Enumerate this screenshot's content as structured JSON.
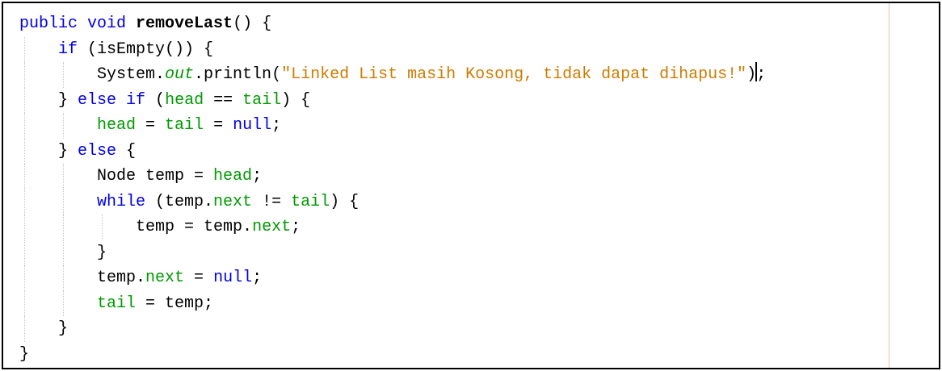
{
  "editor": {
    "lines": [
      {
        "indent": 0,
        "tokens": [
          {
            "t": "public void ",
            "c": "kw"
          },
          {
            "t": "removeLast",
            "c": "fn"
          },
          {
            "t": "() {",
            "c": ""
          }
        ]
      },
      {
        "indent": 1,
        "tokens": [
          {
            "t": "if",
            "c": "kw"
          },
          {
            "t": " (isEmpty()) {",
            "c": ""
          }
        ]
      },
      {
        "indent": 2,
        "tokens": [
          {
            "t": "System.",
            "c": ""
          },
          {
            "t": "out",
            "c": "stat"
          },
          {
            "t": ".println(",
            "c": ""
          },
          {
            "t": "\"Linked List masih Kosong, tidak dapat dihapus!\"",
            "c": "str"
          },
          {
            "t": ")",
            "c": ""
          },
          {
            "t": "|",
            "c": "caret"
          },
          {
            "t": ";",
            "c": ""
          }
        ]
      },
      {
        "indent": 1,
        "tokens": [
          {
            "t": "} ",
            "c": ""
          },
          {
            "t": "else if",
            "c": "kw"
          },
          {
            "t": " (",
            "c": ""
          },
          {
            "t": "head",
            "c": "field"
          },
          {
            "t": " == ",
            "c": ""
          },
          {
            "t": "tail",
            "c": "field"
          },
          {
            "t": ") {",
            "c": ""
          }
        ]
      },
      {
        "indent": 2,
        "tokens": [
          {
            "t": "head",
            "c": "field"
          },
          {
            "t": " = ",
            "c": ""
          },
          {
            "t": "tail",
            "c": "field"
          },
          {
            "t": " = ",
            "c": ""
          },
          {
            "t": "null",
            "c": "kw"
          },
          {
            "t": ";",
            "c": ""
          }
        ]
      },
      {
        "indent": 1,
        "tokens": [
          {
            "t": "} ",
            "c": ""
          },
          {
            "t": "else",
            "c": "kw"
          },
          {
            "t": " {",
            "c": ""
          }
        ]
      },
      {
        "indent": 2,
        "tokens": [
          {
            "t": "Node temp = ",
            "c": ""
          },
          {
            "t": "head",
            "c": "field"
          },
          {
            "t": ";",
            "c": ""
          }
        ]
      },
      {
        "indent": 2,
        "tokens": [
          {
            "t": "while",
            "c": "kw"
          },
          {
            "t": " (temp.",
            "c": ""
          },
          {
            "t": "next",
            "c": "field"
          },
          {
            "t": " != ",
            "c": ""
          },
          {
            "t": "tail",
            "c": "field"
          },
          {
            "t": ") {",
            "c": ""
          }
        ]
      },
      {
        "indent": 3,
        "tokens": [
          {
            "t": "temp = temp.",
            "c": ""
          },
          {
            "t": "next",
            "c": "field"
          },
          {
            "t": ";",
            "c": ""
          }
        ]
      },
      {
        "indent": 2,
        "tokens": [
          {
            "t": "}",
            "c": ""
          }
        ]
      },
      {
        "indent": 2,
        "tokens": [
          {
            "t": "temp.",
            "c": ""
          },
          {
            "t": "next",
            "c": "field"
          },
          {
            "t": " = ",
            "c": ""
          },
          {
            "t": "null",
            "c": "kw"
          },
          {
            "t": ";",
            "c": ""
          }
        ]
      },
      {
        "indent": 2,
        "tokens": [
          {
            "t": "tail",
            "c": "field"
          },
          {
            "t": " = temp;",
            "c": ""
          }
        ]
      },
      {
        "indent": 1,
        "tokens": [
          {
            "t": "}",
            "c": ""
          }
        ]
      },
      {
        "indent": 0,
        "tokens": [
          {
            "t": "}",
            "c": ""
          }
        ]
      }
    ]
  },
  "colors": {
    "keyword": "#0000e6",
    "field": "#009900",
    "string": "#ce7b00",
    "margin_line": "#f0b8b8"
  }
}
